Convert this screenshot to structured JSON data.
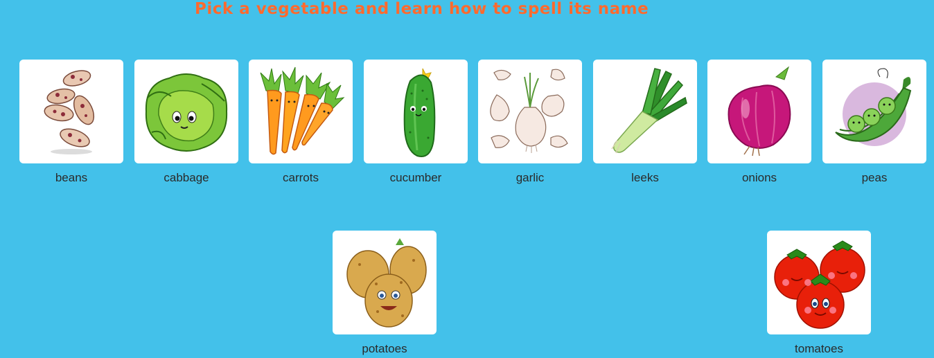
{
  "header": {
    "title": "Pick a vegetable and learn how to spell its name"
  },
  "vegetables": [
    {
      "label": "beans",
      "icon": "beans-icon"
    },
    {
      "label": "cabbage",
      "icon": "cabbage-icon"
    },
    {
      "label": "carrots",
      "icon": "carrots-icon"
    },
    {
      "label": "cucumber",
      "icon": "cucumber-icon"
    },
    {
      "label": "garlic",
      "icon": "garlic-icon"
    },
    {
      "label": "leeks",
      "icon": "leeks-icon"
    },
    {
      "label": "onions",
      "icon": "onions-icon"
    },
    {
      "label": "peas",
      "icon": "peas-icon"
    },
    {
      "label": "potatoes",
      "icon": "potatoes-icon"
    },
    {
      "label": "tomatoes",
      "icon": "tomatoes-icon"
    }
  ],
  "colors": {
    "background": "#43c1ea",
    "title": "#ff6a2e",
    "card": "#ffffff"
  }
}
